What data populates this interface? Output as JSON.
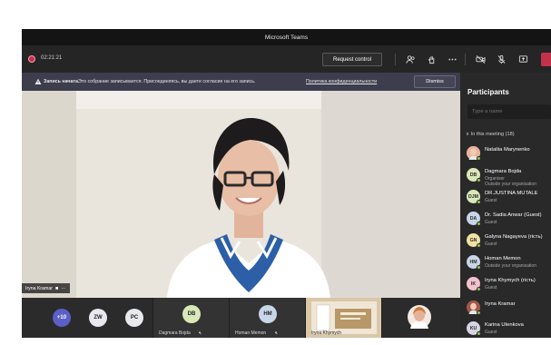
{
  "window": {
    "title": "Microsoft Teams"
  },
  "toolbar": {
    "timer": "02:21:21",
    "request_control_label": "Request control",
    "icons": [
      "participants-icon",
      "raise-hand-icon",
      "more-icon",
      "camera-off-icon",
      "mic-off-icon",
      "share-screen-icon"
    ]
  },
  "banner": {
    "title": "Запись начата.",
    "text": "Это собрание записывается. Присоединяясь, вы даете согласие на его запись.",
    "link": "Политика конфиденциальности",
    "dismiss_label": "Dismiss"
  },
  "main_video": {
    "speaker_name": "Iryna Kramar",
    "more_label": "···"
  },
  "strip": {
    "overflow_count": "+10",
    "avatars": [
      {
        "initials": "ZW",
        "color": "#e8e8ef"
      },
      {
        "initials": "PC",
        "color": "#e8e8ef"
      }
    ],
    "tiles": [
      {
        "initials": "DB",
        "name": "Dagmara Bojda",
        "color": "#d9e8b8"
      },
      {
        "initials": "HM",
        "name": "Homan Memon",
        "color": "#c7d6e8"
      }
    ],
    "shared_tile_name": "Iryna Khymych"
  },
  "panel": {
    "title": "Participants",
    "search_placeholder": "Type a name",
    "section_label": "In this meeting (18)",
    "participants": [
      {
        "name": "Nataliia Marynenko",
        "role": "",
        "role2": "",
        "initials": "",
        "color": "#e9b49a",
        "photo": true
      },
      {
        "name": "Dagmara Bojda",
        "role": "Organiser",
        "role2": "Outside your organisation",
        "initials": "DB",
        "color": "#d9e8b8",
        "photo": false
      },
      {
        "name": "DR.JUSTINA MUTALE",
        "role": "Guest",
        "role2": "",
        "initials": "DJM",
        "color": "#d9e8b8",
        "photo": false
      },
      {
        "name": "Dr. Sadia Anwar (Guest)",
        "role": "Guest",
        "role2": "",
        "initials": "DA",
        "color": "#c7d6e8",
        "photo": false
      },
      {
        "name": "Galyna Nagayeva (гість)",
        "role": "Guest",
        "role2": "",
        "initials": "GN",
        "color": "#f1e2a4",
        "photo": false
      },
      {
        "name": "Homan Memon",
        "role": "Outside your organisation",
        "role2": "",
        "initials": "HM",
        "color": "#c7d6e8",
        "photo": false
      },
      {
        "name": "Iryna Khymych (гість)",
        "role": "Guest",
        "role2": "",
        "initials": "IK",
        "color": "#f2c2cf",
        "photo": false
      },
      {
        "name": "Iryna Kramar",
        "role": "",
        "role2": "",
        "initials": "",
        "color": "#a0584a",
        "photo": true
      },
      {
        "name": "Karina Utenkova",
        "role": "Guest",
        "role2": "",
        "initials": "KU",
        "color": "#d5d5e3",
        "photo": false
      }
    ]
  },
  "colors": {
    "accent_red": "#c4314b",
    "status_green": "#92c353",
    "banner_bg": "#3d3d4d"
  }
}
